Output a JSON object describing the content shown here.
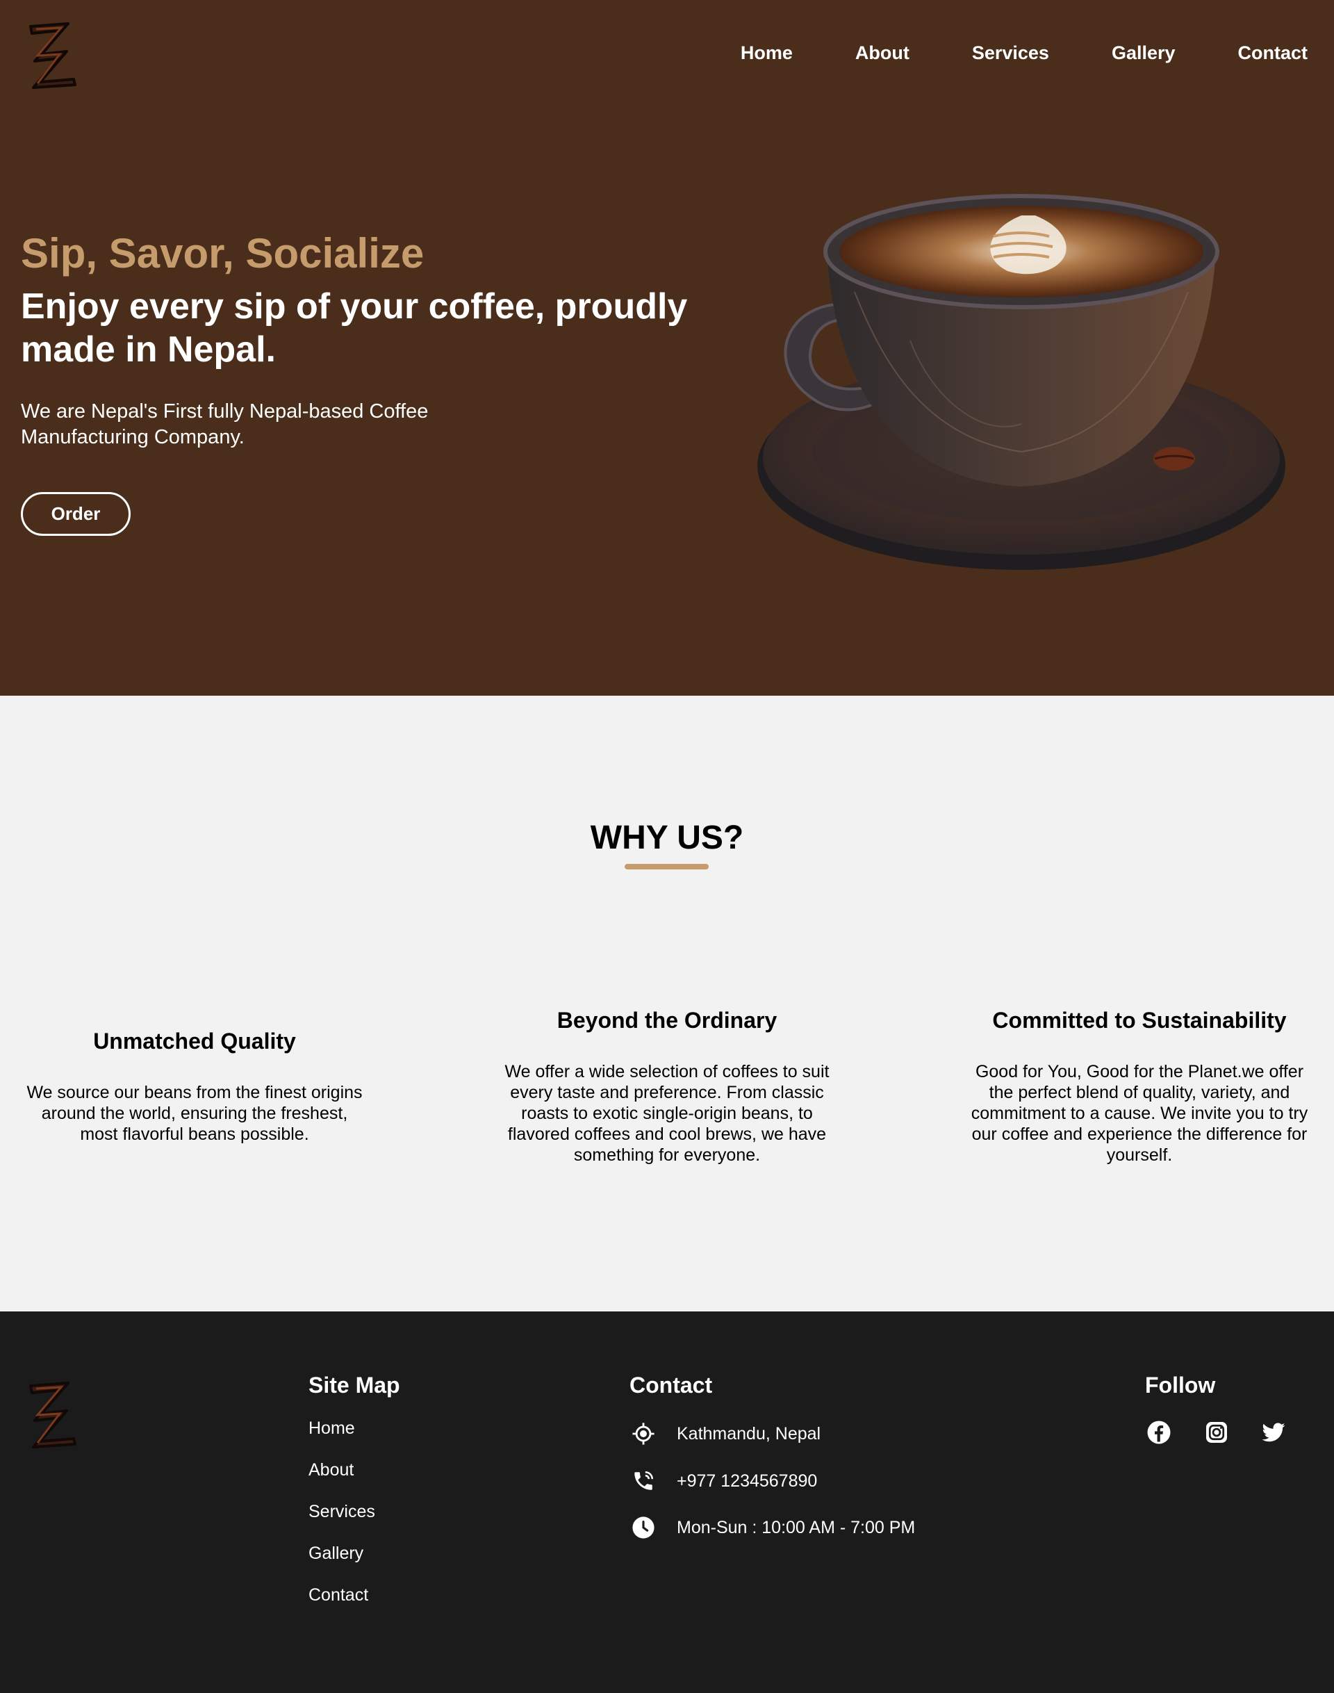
{
  "colors": {
    "hero_bg": "#4a2e1b",
    "accent": "#c69c6d",
    "why_bg": "#f2f2f2",
    "footer_bg": "#1b1b1b"
  },
  "header": {
    "logo_icon": "zz-logo-icon",
    "nav": [
      "Home",
      "About",
      "Services",
      "Gallery",
      "Contact"
    ]
  },
  "hero": {
    "tagline": "Sip, Savor, Socialize",
    "title": "Enjoy every sip of your coffee, proudly made in Nepal.",
    "description": "We are Nepal's First fully Nepal-based Coffee Manufacturing Company.",
    "order_label": "Order",
    "image_icon": "coffee-cup-image"
  },
  "why": {
    "title": "WHY US?",
    "features": [
      {
        "title": "Unmatched Quality",
        "text": "We source our beans from the finest origins around the world, ensuring the freshest, most flavorful beans possible."
      },
      {
        "title": "Beyond the Ordinary",
        "text": "We offer a wide selection of coffees to suit every taste and preference. From classic roasts to exotic single-origin beans, to flavored coffees and cool brews, we have something for everyone."
      },
      {
        "title": "Committed to Sustainability",
        "text": "Good for You, Good for the Planet.we offer the perfect blend of quality, variety, and commitment to a cause. We invite you to try our coffee and experience the difference for yourself."
      }
    ]
  },
  "footer": {
    "sitemap_title": "Site Map",
    "sitemap_links": [
      "Home",
      "About",
      "Services",
      "Gallery",
      "Contact"
    ],
    "contact_title": "Contact",
    "contact_items": [
      {
        "icon": "location-icon",
        "text": "Kathmandu, Nepal"
      },
      {
        "icon": "phone-icon",
        "text": "+977 1234567890"
      },
      {
        "icon": "clock-icon",
        "text": "Mon-Sun : 10:00 AM - 7:00 PM"
      }
    ],
    "follow_title": "Follow",
    "social_icons": [
      "facebook-icon",
      "instagram-icon",
      "twitter-icon"
    ]
  }
}
